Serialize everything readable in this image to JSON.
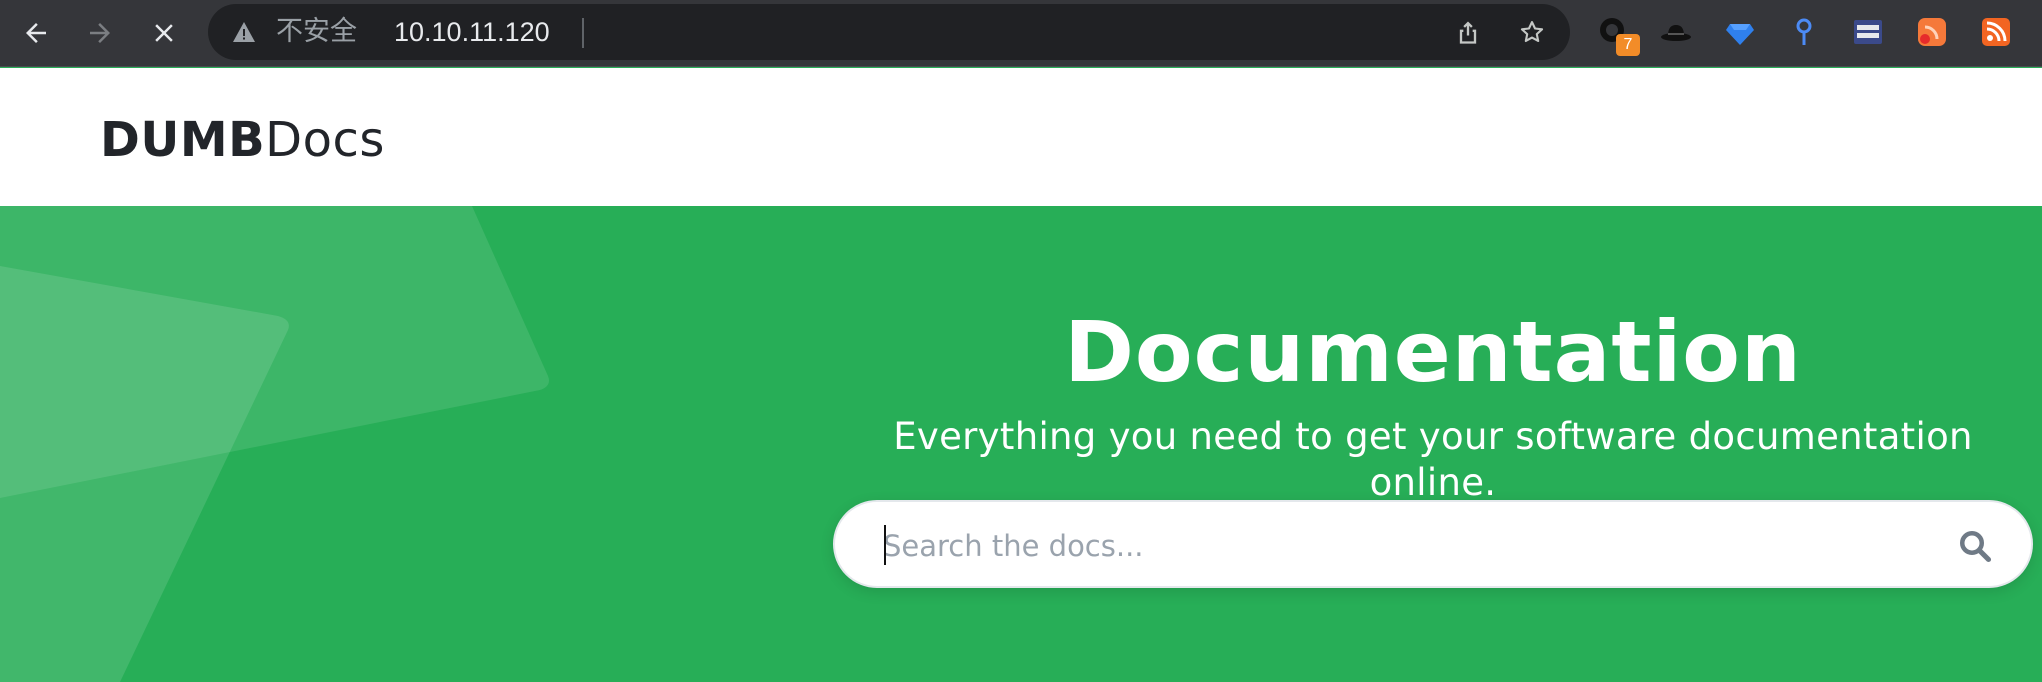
{
  "browser": {
    "security_label": "不安全",
    "url": "10.10.11.120",
    "nav": {
      "back": "arrow-left-icon",
      "forward": "arrow-right-icon",
      "stop": "close-icon"
    },
    "extensions": [
      {
        "name": "ring-extension-icon",
        "badge": "7"
      },
      {
        "name": "hat-extension-icon"
      },
      {
        "name": "diamond-extension-icon"
      },
      {
        "name": "pin-extension-icon"
      },
      {
        "name": "panel-extension-icon"
      },
      {
        "name": "feed-extension-icon"
      },
      {
        "name": "rss-extension-icon"
      }
    ]
  },
  "header": {
    "logo_bold": "DUMB",
    "logo_light": "Docs"
  },
  "hero": {
    "title": "Documentation",
    "subtitle": "Everything you need to get your software documentation online.",
    "search_placeholder": "Search the docs..."
  },
  "colors": {
    "hero_green": "#27ae57",
    "chrome_dark": "#35363a",
    "omnibox": "#202124"
  }
}
